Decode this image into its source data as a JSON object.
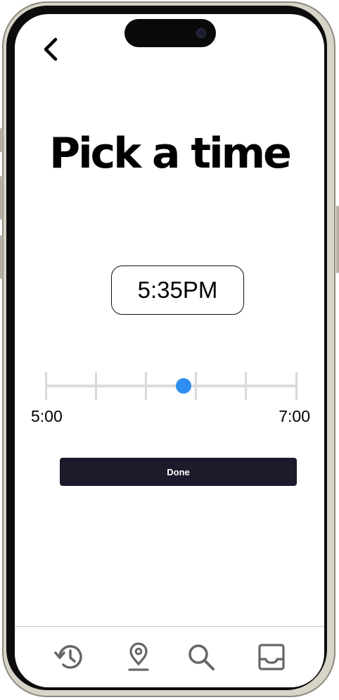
{
  "screen": {
    "title": "Pick a time"
  },
  "nav": {
    "back_icon": "chevron-left-icon"
  },
  "time_picker": {
    "selected_time": "5:35PM",
    "range_min_label": "5:00",
    "range_max_label": "7:00",
    "tick_count": 6,
    "thumb_fraction": 0.55,
    "accent_color": "#2e8def"
  },
  "actions": {
    "done_label": "Done",
    "done_color": "#1e1a2c"
  },
  "tab_bar": {
    "items": [
      {
        "icon": "history-icon"
      },
      {
        "icon": "location-pin-icon"
      },
      {
        "icon": "search-icon"
      },
      {
        "icon": "inbox-icon"
      }
    ]
  }
}
